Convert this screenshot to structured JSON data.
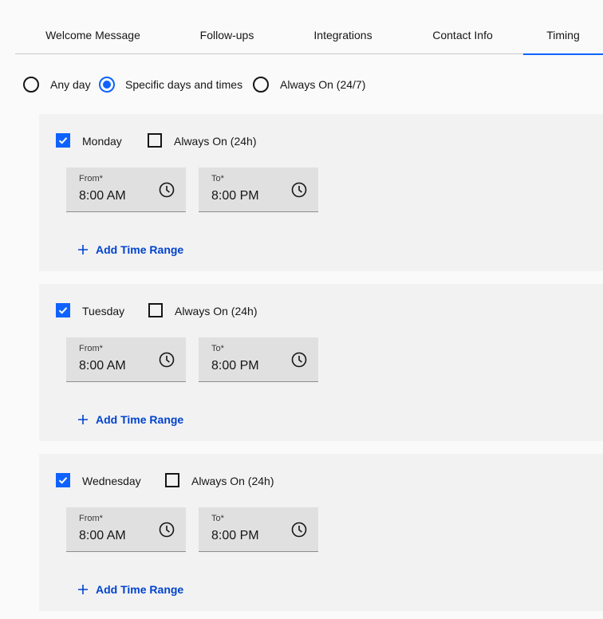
{
  "tabs": [
    {
      "label": "Welcome Message"
    },
    {
      "label": "Follow-ups"
    },
    {
      "label": "Integrations"
    },
    {
      "label": "Contact Info"
    },
    {
      "label": "Timing",
      "active": true
    }
  ],
  "schedule_mode": {
    "options": [
      {
        "label": "Any day",
        "checked": false
      },
      {
        "label": "Specific days and times",
        "checked": true
      },
      {
        "label": "Always On (24/7)",
        "checked": false
      }
    ]
  },
  "days": [
    {
      "name": "Monday",
      "enabled": true,
      "always_on_label": "Always On (24h)",
      "always_on": false,
      "from_label": "From*",
      "from_value": "8:00 AM",
      "to_label": "To*",
      "to_value": "8:00 PM",
      "add_label": "Add Time Range"
    },
    {
      "name": "Tuesday",
      "enabled": true,
      "always_on_label": "Always On (24h)",
      "always_on": false,
      "from_label": "From*",
      "from_value": "8:00 AM",
      "to_label": "To*",
      "to_value": "8:00 PM",
      "add_label": "Add Time Range"
    },
    {
      "name": "Wednesday",
      "enabled": true,
      "always_on_label": "Always On (24h)",
      "always_on": false,
      "from_label": "From*",
      "from_value": "8:00 AM",
      "to_label": "To*",
      "to_value": "8:00 PM",
      "add_label": "Add Time Range"
    }
  ],
  "colors": {
    "accent": "#0f62fe",
    "link": "#0043ce",
    "card_bg": "#f2f2f2",
    "field_bg": "#e0e0e0"
  }
}
